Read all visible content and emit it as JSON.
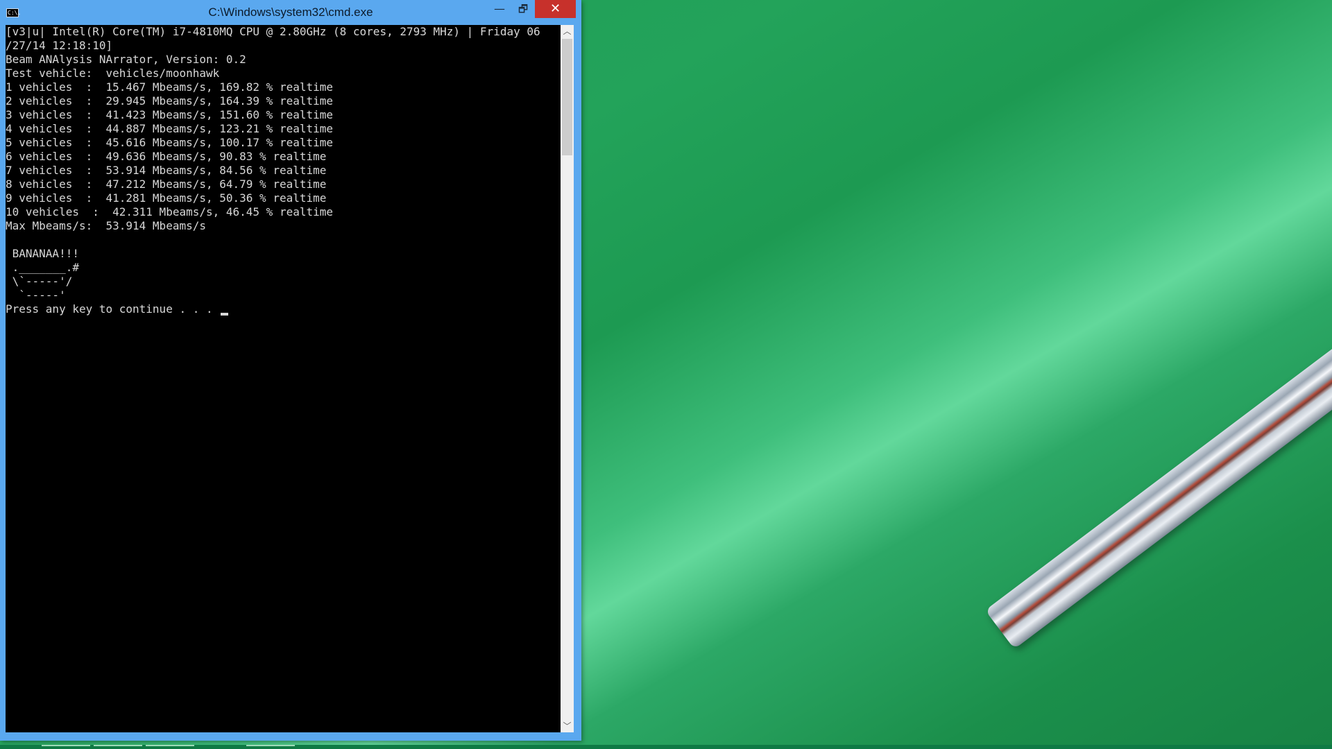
{
  "window": {
    "title": "C:\\Windows\\system32\\cmd.exe",
    "icon_glyph": "C:\\.",
    "minimize_glyph": "—",
    "maximize_glyph": "🗗",
    "close_glyph": "✕"
  },
  "console": {
    "lines": [
      "[v3|u| Intel(R) Core(TM) i7-4810MQ CPU @ 2.80GHz (8 cores, 2793 MHz) | Friday 06",
      "/27/14 12:18:10]",
      "Beam ANAlysis NArrator, Version: 0.2",
      "Test vehicle:  vehicles/moonhawk",
      "1 vehicles  :  15.467 Mbeams/s, 169.82 % realtime",
      "2 vehicles  :  29.945 Mbeams/s, 164.39 % realtime",
      "3 vehicles  :  41.423 Mbeams/s, 151.60 % realtime",
      "4 vehicles  :  44.887 Mbeams/s, 123.21 % realtime",
      "5 vehicles  :  45.616 Mbeams/s, 100.17 % realtime",
      "6 vehicles  :  49.636 Mbeams/s, 90.83 % realtime",
      "7 vehicles  :  53.914 Mbeams/s, 84.56 % realtime",
      "8 vehicles  :  47.212 Mbeams/s, 64.79 % realtime",
      "9 vehicles  :  41.281 Mbeams/s, 50.36 % realtime",
      "10 vehicles  :  42.311 Mbeams/s, 46.45 % realtime",
      "Max Mbeams/s:  53.914 Mbeams/s",
      "",
      " BANANAA!!!",
      " ._______.#",
      " \\`-----'/",
      "  `-----'",
      "Press any key to continue . . . "
    ]
  },
  "scrollbar": {
    "up_glyph": "︿",
    "down_glyph": "﹀"
  },
  "colors": {
    "titlebar": "#5aa8ef",
    "close_button": "#c7312b",
    "console_bg": "#000000",
    "console_fg": "#d7d7d7",
    "desktop_green": "#1f9a55"
  }
}
